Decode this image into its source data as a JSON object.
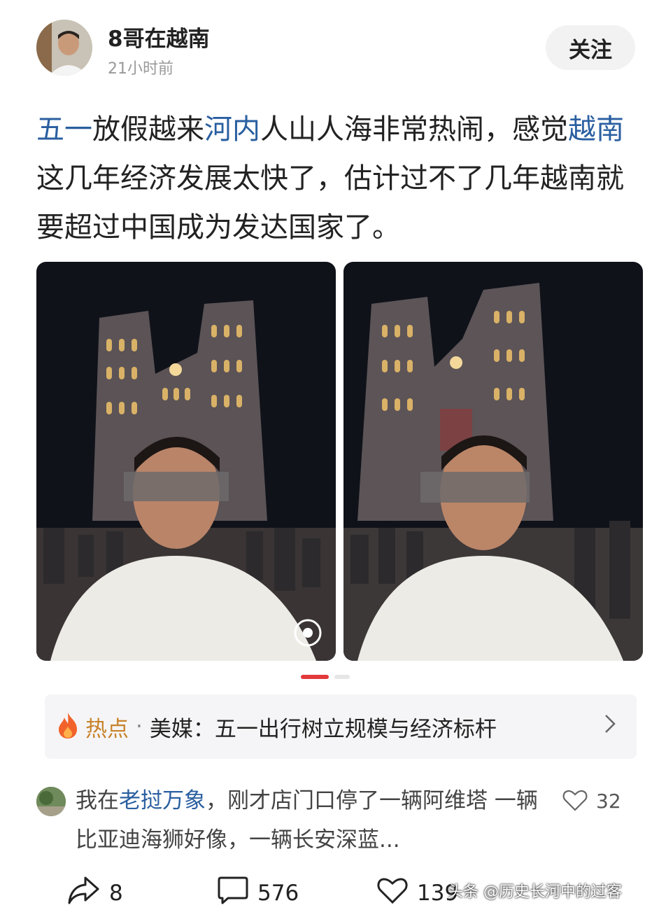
{
  "header": {
    "author": "8哥在越南",
    "time": "21小时前",
    "follow_label": "关注"
  },
  "post": {
    "seg1": "五一",
    "seg2": "放假越来",
    "seg3": "河内",
    "seg4": "人山人海非常热闹，感觉",
    "seg5": "越南",
    "seg6": "这几年经济发展太快了，估计过不了几年越南就要超过中国成为发达国家了。"
  },
  "hot": {
    "label": "热点",
    "dot": "·",
    "headline": "美媒：五一出行树立规模与经济标杆"
  },
  "comment": {
    "prefix": "我在",
    "link": "老挝万象",
    "text": "，刚才店门口停了一辆阿维塔 一辆比亚迪海狮好像，一辆长安深蓝...",
    "likes": "32"
  },
  "actions": {
    "share_count": "8",
    "comment_count": "576",
    "like_count": "139"
  },
  "watermark": "头条 @历史长河中的过客",
  "colors": {
    "link": "#2a5fa0",
    "hot_label": "#c8822b",
    "indicator_active": "#e3393c"
  }
}
